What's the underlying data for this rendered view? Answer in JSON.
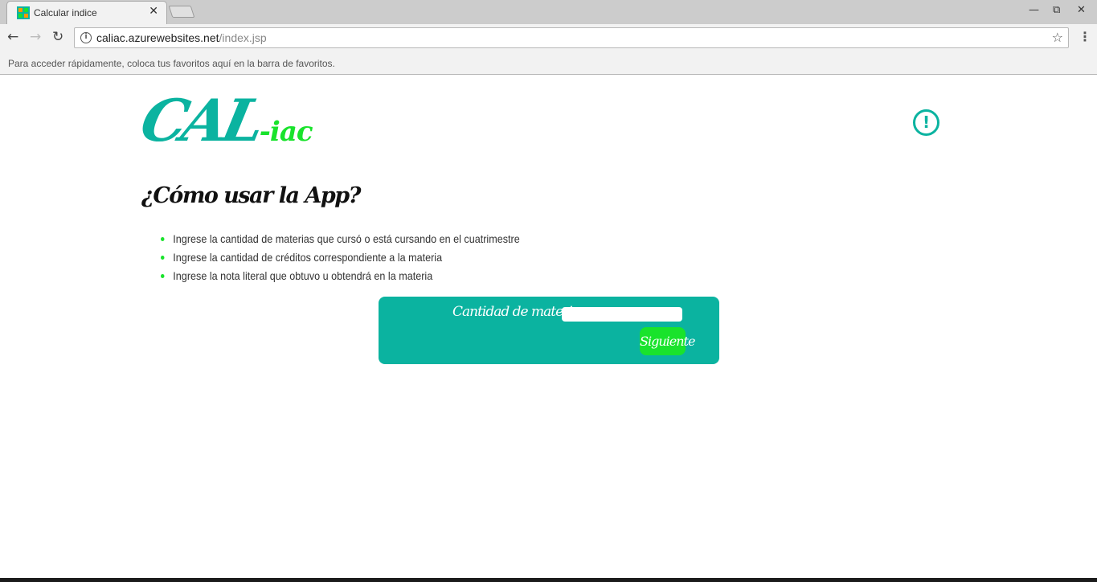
{
  "browser": {
    "tab_title": "Calcular indice",
    "tab_close": "✕",
    "url_domain": "caliac.azurewebsites.net",
    "url_path": "/index.jsp",
    "bookmarks_hint": "Para acceder rápidamente, coloca tus favoritos aquí en la barra de favoritos.",
    "window_controls": {
      "minimize": "—",
      "restore": "⧉",
      "close": "✕"
    },
    "nav": {
      "back": "←",
      "forward": "→",
      "reload": "↻"
    }
  },
  "header": {
    "logo_main": "CAL",
    "logo_suffix": "-iac",
    "alert_icon": "exclamation-circle",
    "alert_glyph": "!"
  },
  "instructions": {
    "title": "¿Cómo usar la App?",
    "steps": [
      "Ingrese la cantidad de materias que cursó o está cursando en el cuatrimestre",
      "Ingrese la cantidad de créditos correspondiente a la materia",
      "Ingrese la nota literal que obtuvo u obtendrá en la materia"
    ]
  },
  "form": {
    "label": "Cantidad de materias:",
    "input_value": "",
    "submit_label": "Siguiente"
  },
  "colors": {
    "brand_teal": "#0bb3a0",
    "accent_green": "#19e32c"
  }
}
